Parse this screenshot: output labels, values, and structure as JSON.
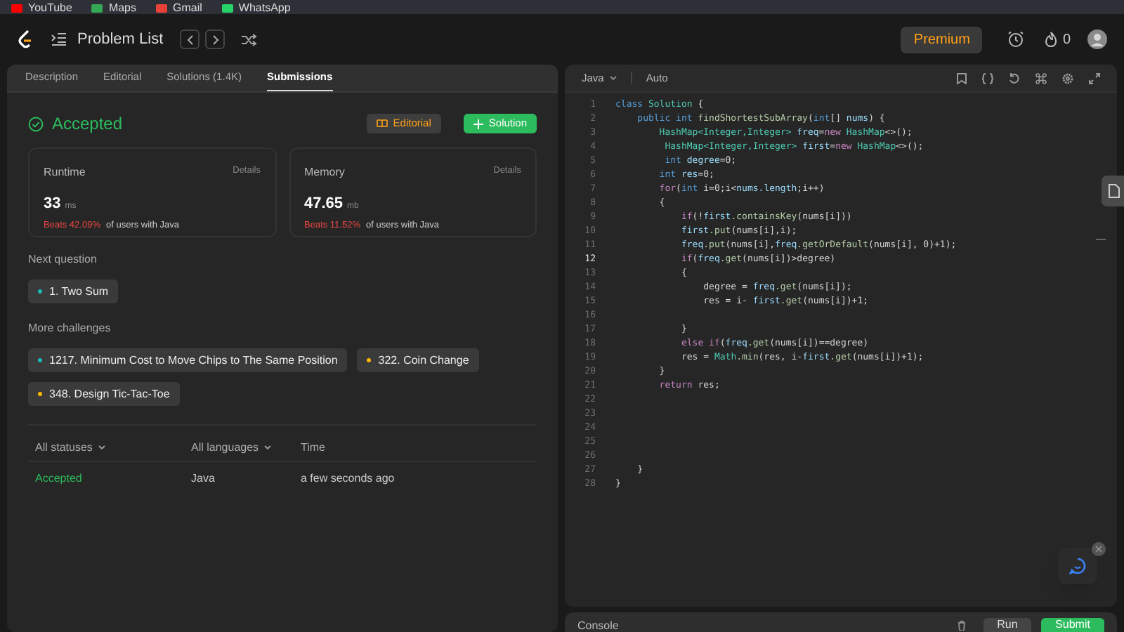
{
  "bookmarks": [
    {
      "label": "YouTube",
      "color": "#ff0000"
    },
    {
      "label": "Maps",
      "color": "#34a853"
    },
    {
      "label": "Gmail",
      "color": "#ea4335"
    },
    {
      "label": "WhatsApp",
      "color": "#25d366"
    }
  ],
  "nav": {
    "title": "Problem List",
    "premium": "Premium",
    "streak": "0"
  },
  "tabs": [
    {
      "label": "Description",
      "selected": false
    },
    {
      "label": "Editorial",
      "selected": false
    },
    {
      "label": "Solutions (1.4K)",
      "selected": false
    },
    {
      "label": "Submissions",
      "selected": true
    }
  ],
  "result": {
    "status": "Accepted",
    "editorial_button": "Editorial",
    "solution_button": "Solution"
  },
  "stats": [
    {
      "title": "Runtime",
      "details": "Details",
      "value": "33",
      "unit": "ms",
      "beats": "Beats 42.09%",
      "suffix": "of users with Java"
    },
    {
      "title": "Memory",
      "details": "Details",
      "value": "47.65",
      "unit": "mb",
      "beats": "Beats 11.52%",
      "suffix": "of users with Java"
    }
  ],
  "next_question": {
    "label": "Next question",
    "items": [
      {
        "title": "1. Two Sum",
        "color": "#1cb8b8"
      }
    ]
  },
  "more_challenges": {
    "label": "More challenges",
    "items": [
      {
        "title": "1217. Minimum Cost to Move Chips to The Same Position",
        "color": "#1cb8b8"
      },
      {
        "title": "322. Coin Change",
        "color": "#ffb800"
      },
      {
        "title": "348. Design Tic-Tac-Toe",
        "color": "#ffb800"
      }
    ]
  },
  "submissions": {
    "columns": [
      {
        "label": "All statuses",
        "kind": "dropdown"
      },
      {
        "label": "All languages",
        "kind": "dropdown"
      },
      {
        "label": "Time",
        "kind": "plain"
      }
    ],
    "rows": [
      {
        "status": "Accepted",
        "language": "Java",
        "time": "a few seconds ago"
      }
    ]
  },
  "editor": {
    "language": "Java",
    "mode": "Auto",
    "lines": [
      {
        "number": "1",
        "current": false,
        "tokens": [
          {
            "text": "class ",
            "kind": "keyword"
          },
          {
            "text": "Solution",
            "kind": "type"
          },
          {
            "text": " {",
            "kind": "plain"
          }
        ]
      },
      {
        "number": "2",
        "current": false,
        "tokens": [
          {
            "text": "    public int ",
            "kind": "keyword"
          },
          {
            "text": "findShortestSubArray",
            "kind": "function"
          },
          {
            "text": "(",
            "kind": "plain"
          },
          {
            "text": "int",
            "kind": "keyword"
          },
          {
            "text": "[] ",
            "kind": "plain"
          },
          {
            "text": "nums",
            "kind": "variable"
          },
          {
            "text": ") {",
            "kind": "plain"
          }
        ]
      },
      {
        "number": "3",
        "current": false,
        "tokens": [
          {
            "text": "        HashMap<Integer,Integer> ",
            "kind": "type"
          },
          {
            "text": "freq",
            "kind": "variable"
          },
          {
            "text": "=",
            "kind": "plain"
          },
          {
            "text": "new ",
            "kind": "control"
          },
          {
            "text": "HashMap",
            "kind": "type"
          },
          {
            "text": "<>();",
            "kind": "plain"
          }
        ]
      },
      {
        "number": "4",
        "current": false,
        "tokens": [
          {
            "text": "         HashMap<Integer,Integer> ",
            "kind": "type"
          },
          {
            "text": "first",
            "kind": "variable"
          },
          {
            "text": "=",
            "kind": "plain"
          },
          {
            "text": "new ",
            "kind": "control"
          },
          {
            "text": "HashMap",
            "kind": "type"
          },
          {
            "text": "<>();",
            "kind": "plain"
          }
        ]
      },
      {
        "number": "5",
        "current": false,
        "tokens": [
          {
            "text": "         int ",
            "kind": "keyword"
          },
          {
            "text": "degree",
            "kind": "variable"
          },
          {
            "text": "=0;",
            "kind": "plain"
          }
        ]
      },
      {
        "number": "6",
        "current": false,
        "tokens": [
          {
            "text": "        int ",
            "kind": "keyword"
          },
          {
            "text": "res",
            "kind": "variable"
          },
          {
            "text": "=0;",
            "kind": "plain"
          }
        ]
      },
      {
        "number": "7",
        "current": false,
        "tokens": [
          {
            "text": "        for",
            "kind": "control"
          },
          {
            "text": "(",
            "kind": "plain"
          },
          {
            "text": "int",
            "kind": "keyword"
          },
          {
            "text": " i=0;i<",
            "kind": "plain"
          },
          {
            "text": "nums.length",
            "kind": "variable"
          },
          {
            "text": ";i++)",
            "kind": "plain"
          }
        ]
      },
      {
        "number": "8",
        "current": false,
        "tokens": [
          {
            "text": "        {",
            "kind": "plain"
          }
        ]
      },
      {
        "number": "9",
        "current": false,
        "tokens": [
          {
            "text": "            if",
            "kind": "control"
          },
          {
            "text": "(!",
            "kind": "plain"
          },
          {
            "text": "first",
            "kind": "variable"
          },
          {
            "text": ".containsKey",
            "kind": "function"
          },
          {
            "text": "(nums[i]))",
            "kind": "plain"
          }
        ]
      },
      {
        "number": "10",
        "current": false,
        "tokens": [
          {
            "text": "            first",
            "kind": "variable"
          },
          {
            "text": ".put",
            "kind": "function"
          },
          {
            "text": "(nums[i],i);",
            "kind": "plain"
          }
        ]
      },
      {
        "number": "11",
        "current": false,
        "tokens": [
          {
            "text": "            freq",
            "kind": "variable"
          },
          {
            "text": ".put",
            "kind": "function"
          },
          {
            "text": "(nums[i],",
            "kind": "plain"
          },
          {
            "text": "freq",
            "kind": "variable"
          },
          {
            "text": ".getOrDefault",
            "kind": "function"
          },
          {
            "text": "(nums[i], 0)+1);",
            "kind": "plain"
          }
        ]
      },
      {
        "number": "12",
        "current": true,
        "tokens": [
          {
            "text": "            if",
            "kind": "control"
          },
          {
            "text": "(",
            "kind": "plain"
          },
          {
            "text": "freq",
            "kind": "variable"
          },
          {
            "text": ".get",
            "kind": "function"
          },
          {
            "text": "(nums[i])>degree)",
            "kind": "plain"
          }
        ]
      },
      {
        "number": "13",
        "current": false,
        "tokens": [
          {
            "text": "            {",
            "kind": "plain"
          }
        ]
      },
      {
        "number": "14",
        "current": false,
        "tokens": [
          {
            "text": "                degree = ",
            "kind": "plain"
          },
          {
            "text": "freq",
            "kind": "variable"
          },
          {
            "text": ".get",
            "kind": "function"
          },
          {
            "text": "(nums[i]);",
            "kind": "plain"
          }
        ]
      },
      {
        "number": "15",
        "current": false,
        "tokens": [
          {
            "text": "                res = i- ",
            "kind": "plain"
          },
          {
            "text": "first",
            "kind": "variable"
          },
          {
            "text": ".get",
            "kind": "function"
          },
          {
            "text": "(nums[i])+1;",
            "kind": "plain"
          }
        ]
      },
      {
        "number": "16",
        "current": false
      },
      {
        "number": "17",
        "current": false,
        "tokens": [
          {
            "text": "            }",
            "kind": "plain"
          }
        ]
      },
      {
        "number": "18",
        "current": false,
        "tokens": [
          {
            "text": "            else if",
            "kind": "control"
          },
          {
            "text": "(",
            "kind": "plain"
          },
          {
            "text": "freq",
            "kind": "variable"
          },
          {
            "text": ".get",
            "kind": "function"
          },
          {
            "text": "(nums[i])==degree)",
            "kind": "plain"
          }
        ]
      },
      {
        "number": "19",
        "current": false,
        "tokens": [
          {
            "text": "            res = ",
            "kind": "plain"
          },
          {
            "text": "Math",
            "kind": "type"
          },
          {
            "text": ".min",
            "kind": "function"
          },
          {
            "text": "(res, i-",
            "kind": "plain"
          },
          {
            "text": "first",
            "kind": "variable"
          },
          {
            "text": ".get",
            "kind": "function"
          },
          {
            "text": "(nums[i])+1);",
            "kind": "plain"
          }
        ]
      },
      {
        "number": "20",
        "current": false,
        "tokens": [
          {
            "text": "        }",
            "kind": "plain"
          }
        ]
      },
      {
        "number": "21",
        "current": false,
        "tokens": [
          {
            "text": "        return",
            "kind": "control"
          },
          {
            "text": " res;",
            "kind": "plain"
          }
        ]
      },
      {
        "number": "22",
        "current": false
      },
      {
        "number": "23",
        "current": false
      },
      {
        "number": "24",
        "current": false
      },
      {
        "number": "25",
        "current": false
      },
      {
        "number": "26",
        "current": false
      },
      {
        "number": "27",
        "current": false,
        "tokens": [
          {
            "text": "    }",
            "kind": "plain"
          }
        ]
      },
      {
        "number": "28",
        "current": false,
        "tokens": [
          {
            "text": "}",
            "kind": "plain"
          }
        ]
      }
    ]
  },
  "console": {
    "label": "Console",
    "run": "Run",
    "submit": "Submit"
  }
}
